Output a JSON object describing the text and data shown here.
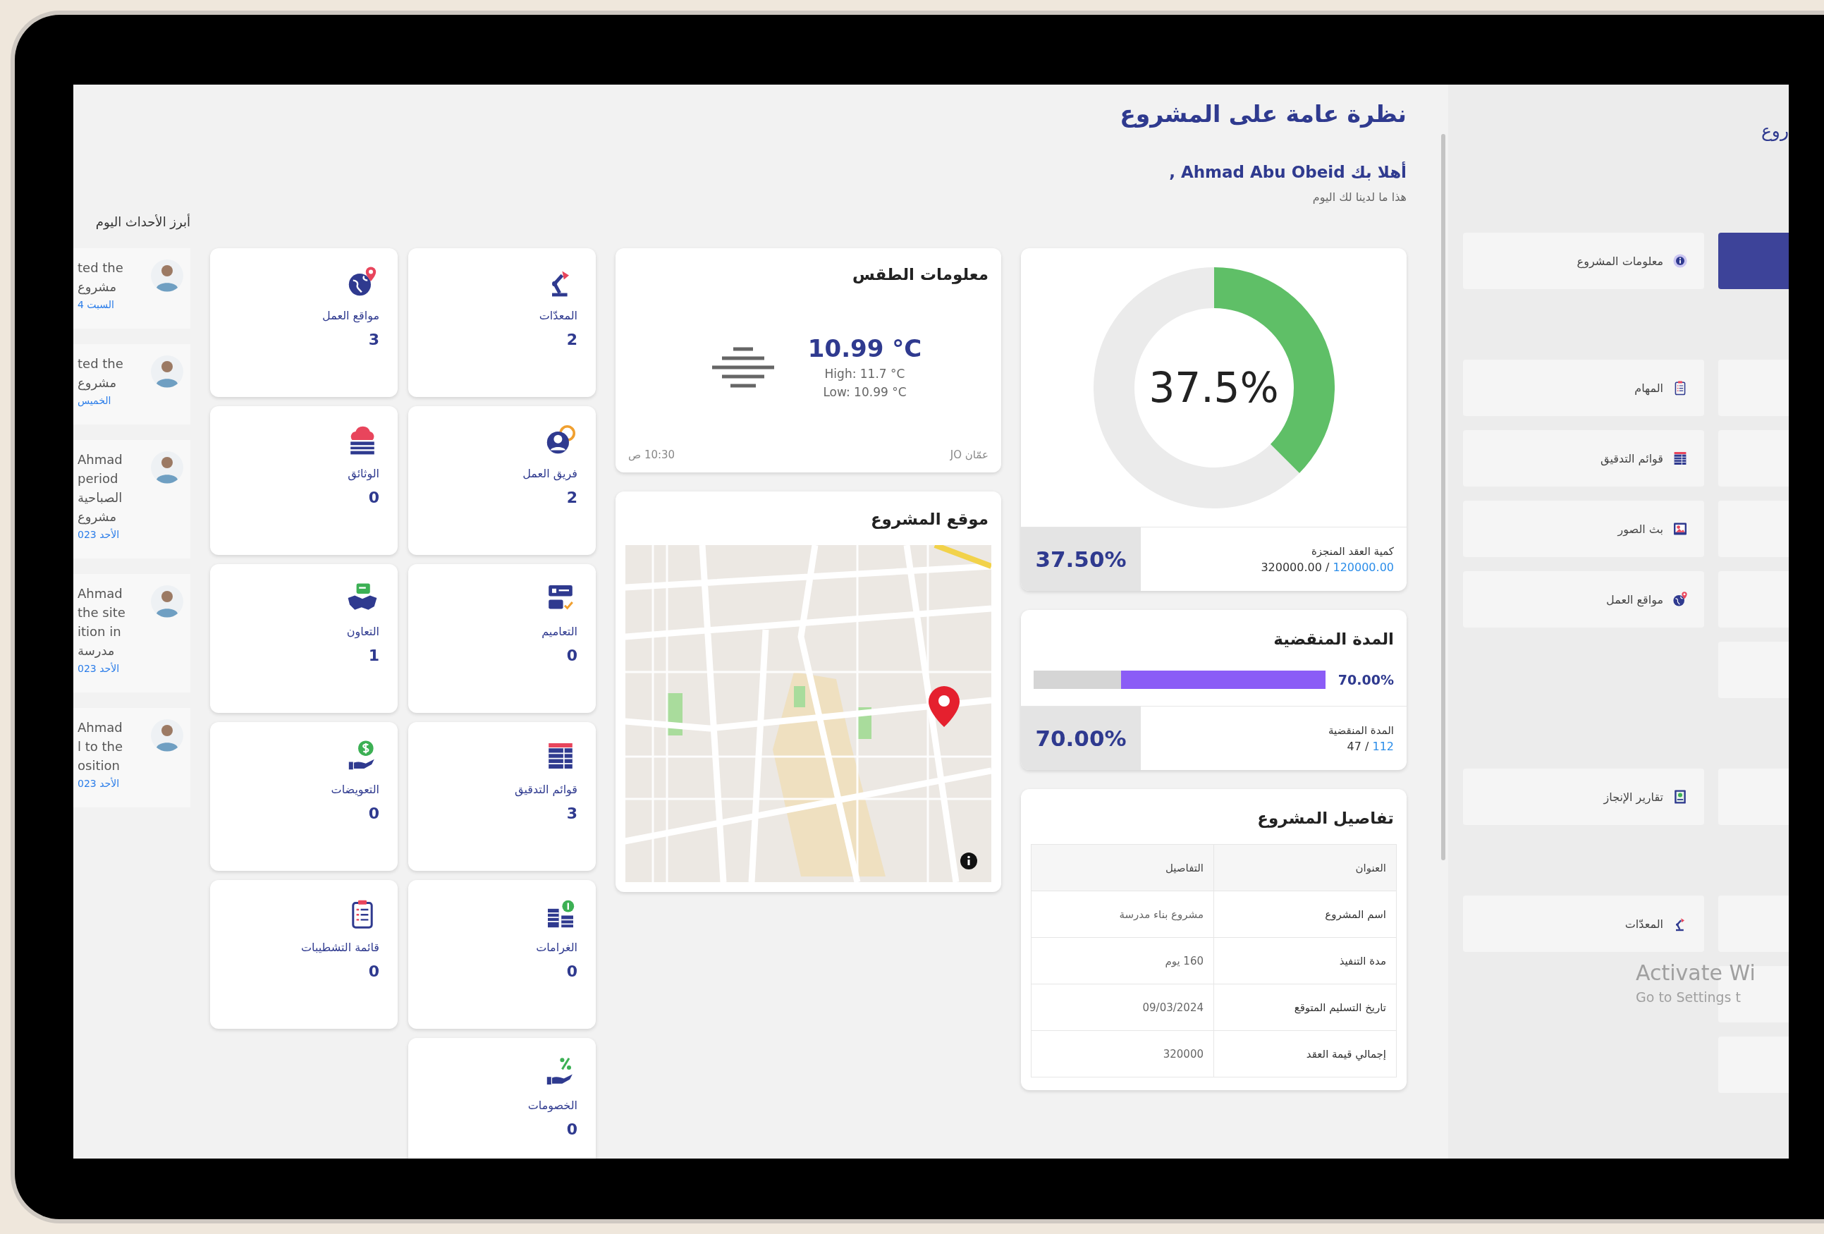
{
  "header": {
    "title": "نظرة عامة على المشروع",
    "greeting": "أهلا بك Ahmad Abu Obeid ,",
    "subtitle": "هذا ما لدينا لك اليوم"
  },
  "progress": {
    "chart_data": {
      "type": "donut",
      "values": [
        37.5,
        62.5
      ]
    },
    "label": "37.5%",
    "percent": "37.50%",
    "caption": "كمية العقد المنجزة",
    "total": "320000.00 /",
    "done": "120000.00"
  },
  "duration": {
    "title": "المدة المنقضية",
    "level": 0.7,
    "bar_label": "70.00%",
    "percent": "70.00%",
    "caption": "المدة المنقضية",
    "elapsed": "47 /",
    "total": "112"
  },
  "details": {
    "title": "تفاصيل المشروع",
    "columns": [
      "العنوان",
      "التفاصيل"
    ],
    "rows": [
      [
        "اسم المشروع",
        "مشروع بناء مدرسة"
      ],
      [
        "مدة التنفيذ",
        "160 يوم"
      ],
      [
        "تاريخ التسليم المتوقع",
        "09/03/2024"
      ],
      [
        "إجمالي قيمة العقد",
        "320000"
      ]
    ]
  },
  "weather": {
    "title": "معلومات الطقس",
    "temperature": "10.99 °C",
    "high": "High: 11.7 °C",
    "low": "Low: 10.99 °C",
    "location": "عمّان JO",
    "time": "10:30 ص"
  },
  "map": {
    "title": "موقع المشروع"
  },
  "stats": [
    {
      "label": "المعدّات",
      "value": "2"
    },
    {
      "label": "مواقع العمل",
      "value": "3"
    },
    {
      "label": "فريق العمل",
      "value": "2"
    },
    {
      "label": "الوثائق",
      "value": "0"
    },
    {
      "label": "التعاميم",
      "value": "0"
    },
    {
      "label": "التعاون",
      "value": "1"
    },
    {
      "label": "قوائم التدقيق",
      "value": "3"
    },
    {
      "label": "التعويضات",
      "value": "0"
    },
    {
      "label": "الغرامات",
      "value": "0"
    },
    {
      "label": "قائمة التشطيبات",
      "value": "0"
    },
    {
      "label": "الخصومات",
      "value": "0"
    }
  ],
  "events": {
    "title": "أبرز الأحداث اليوم",
    "items": [
      {
        "lines": [
          "ted the",
          "مشروع"
        ],
        "date": "السبت 4"
      },
      {
        "lines": [
          "ted the",
          "مشروع"
        ],
        "date": "الخميس"
      },
      {
        "lines": [
          "Ahmad",
          "period",
          "الصباحية",
          "مشروع"
        ],
        "date": "الأحد 023"
      },
      {
        "lines": [
          "Ahmad",
          "the site",
          "ition in",
          "مدرسة"
        ],
        "date": "الأحد 023"
      },
      {
        "lines": [
          "Ahmad",
          "l to the",
          "osition"
        ],
        "date": "الأحد 023"
      }
    ]
  },
  "sidebar": {
    "title": "روع",
    "sections": [
      {
        "rows": [
          {
            "left": {
              "label": "معلومات المشروع",
              "selected": false
            },
            "right": {
              "selected": true
            }
          }
        ]
      },
      {
        "rows": [
          {
            "left": {
              "label": "المهام",
              "selected": false
            },
            "right": {
              "selected": false
            }
          },
          {
            "left": {
              "label": "قوائم التدقيق",
              "selected": false
            },
            "right": {
              "selected": false
            }
          },
          {
            "left": {
              "label": "بث الصور",
              "selected": false
            },
            "right": {
              "selected": false
            }
          },
          {
            "left": {
              "label": "مواقع العمل",
              "selected": false
            },
            "right": {
              "selected": false
            }
          },
          {
            "right": {
              "selected": false
            }
          }
        ]
      },
      {
        "rows": [
          {
            "left": {
              "label": "تقارير الإنجاز",
              "selected": false
            },
            "right": {
              "selected": false
            }
          }
        ]
      },
      {
        "rows": [
          {
            "left": {
              "label": "المعدّات",
              "selected": false
            },
            "right": {
              "selected": false
            }
          },
          {
            "right": {
              "selected": false
            }
          },
          {
            "right": {
              "selected": false
            }
          }
        ]
      }
    ]
  },
  "os_notice": {
    "title": "Activate Wi",
    "subtitle": "Go to Settings t"
  }
}
